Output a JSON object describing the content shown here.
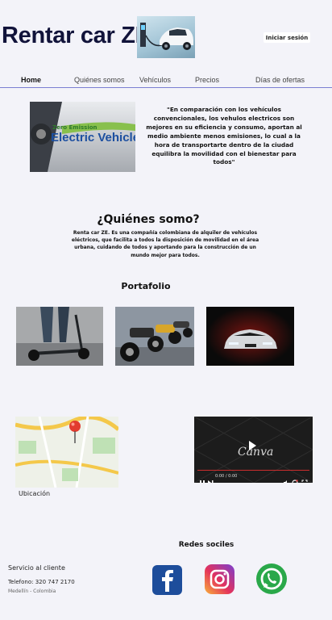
{
  "header": {
    "brand": "Rentar car ZE",
    "login_label": "Iniciar sesión"
  },
  "nav": {
    "items": [
      {
        "label": "Home",
        "active": true
      },
      {
        "label": "Quiénes somos",
        "active": false
      },
      {
        "label": "Vehículos",
        "active": false
      },
      {
        "label": "Precios",
        "active": false
      },
      {
        "label": "Días de ofertas",
        "active": false
      }
    ]
  },
  "hero": {
    "image_text": "Electric Vehicle",
    "image_subtext": "Zero Emission",
    "quote": "\"En comparación con los vehículos convencionales, los vehulos electricos son mejores en su eficiencia y consumo, aportan al medio ambiente menos emisiones, lo cual a la hora de transportarte dentro de la ciudad equilibra la movilidad con el bienestar para todos\""
  },
  "about": {
    "title": "¿Quiénes somo?",
    "text": "Renta car ZE. Es una compañía colombiana de alquiler de vehículos eléctricos, que facilita a todos la disposición de movilidad en el área urbana, cuidando de todos y aportando para la construcción de un mundo mejor para todos."
  },
  "portfolio": {
    "title": "Portafolio"
  },
  "media": {
    "map_label": "Ubicación",
    "video_watermark": "Canva",
    "video_time": "0:00 / 0:00"
  },
  "social": {
    "title": "Redes sociles",
    "icons": [
      "facebook-icon",
      "instagram-icon",
      "whatsapp-icon"
    ]
  },
  "footer": {
    "service": "Servicio al cliente",
    "phone": "Telefono: 320 747 2170",
    "city": "Medellín - Colombia"
  },
  "colors": {
    "background": "#f3f3f9",
    "nav_line": "#7b7fd2",
    "brand_text": "#11133a"
  }
}
